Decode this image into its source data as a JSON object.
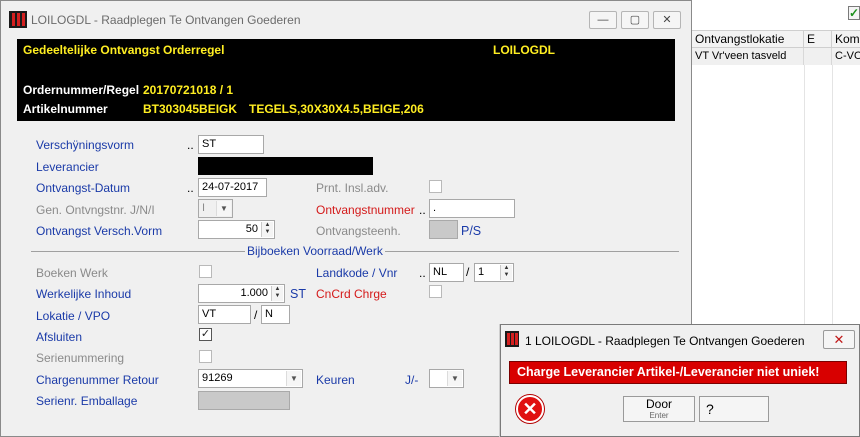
{
  "background_list": {
    "columns": [
      "Ontvangstlokatie",
      "E",
      "Kom"
    ],
    "row": [
      "VT Vr'veen tasveld",
      "",
      "C-VO"
    ]
  },
  "main_window": {
    "title": "LOILOGDL - Raadplegen Te Ontvangen Goederen",
    "minimize": "—",
    "maximize": "▢",
    "close": "✕"
  },
  "header_panel": {
    "title": "Gedeeltelijke Ontvangst Orderregel",
    "code": "LOILOGDL",
    "order_label": "Ordernummer/Regel",
    "order_value": "20170721018 / 1",
    "article_label": "Artikelnummer",
    "article_value": "BT303045BEIGK",
    "article_desc": "TEGELS,30X30X4.5,BEIGE,206"
  },
  "form": {
    "verschijningsvorm": {
      "label": "Verschÿningsvorm",
      "dots": "..",
      "value": "ST"
    },
    "leverancier": {
      "label": "Leverancier"
    },
    "ontvangst_datum": {
      "label": "Ontvangst-Datum",
      "dots": "..",
      "value": "24-07-2017"
    },
    "prnt_insl": {
      "label": "Prnt. Insl.adv."
    },
    "gen_ontvngstnr": {
      "label": "Gen. Ontvngstnr. J/N/I",
      "value": "I"
    },
    "ontvangstnummer": {
      "label": "Ontvangstnummer",
      "dots": "..",
      "value": "."
    },
    "ontvangst_versch": {
      "label": "Ontvangst Versch.Vorm",
      "value": "50"
    },
    "ontvangsteenh": {
      "label": "Ontvangsteenh.",
      "suffix": "P/S"
    },
    "section_title": "Bijboeken Voorraad/Werk",
    "boeken_werk": {
      "label": "Boeken Werk"
    },
    "landkode": {
      "label": "Landkode / Vnr",
      "dots": "..",
      "value": "NL",
      "sep": "/",
      "value2": "1"
    },
    "werkelijke_inhoud": {
      "label": "Werkelijke Inhoud",
      "value": "1.000",
      "unit": "ST"
    },
    "cncrd": {
      "label": "CnCrd Chrge"
    },
    "lokatie": {
      "label": "Lokatie / VPO",
      "value": "VT",
      "sep": "/",
      "value2": "N"
    },
    "afsluiten": {
      "label": "Afsluiten",
      "checked": "✓"
    },
    "serienummering": {
      "label": "Serienummering"
    },
    "chargenummer": {
      "label": "Chargenummer Retour",
      "value": "91269"
    },
    "keuren": {
      "label": "Keuren",
      "jn": "J/-"
    },
    "serienr_emballage": {
      "label": "Serienr. Emballage"
    }
  },
  "dialog": {
    "title": "1 LOILOGDL - Raadplegen Te Ontvangen Goederen",
    "close": "✕",
    "message": "Charge Leverancier Artikel-/Leverancier niet uniek!",
    "error_icon": "✕",
    "door_label": "Door",
    "door_hint": "Enter",
    "help_glyph": "?"
  },
  "colors": {
    "label_blue": "#1a3aa8",
    "label_red": "#d41a1a",
    "header_yellow": "#ffee22",
    "banner_red": "#d80000"
  }
}
